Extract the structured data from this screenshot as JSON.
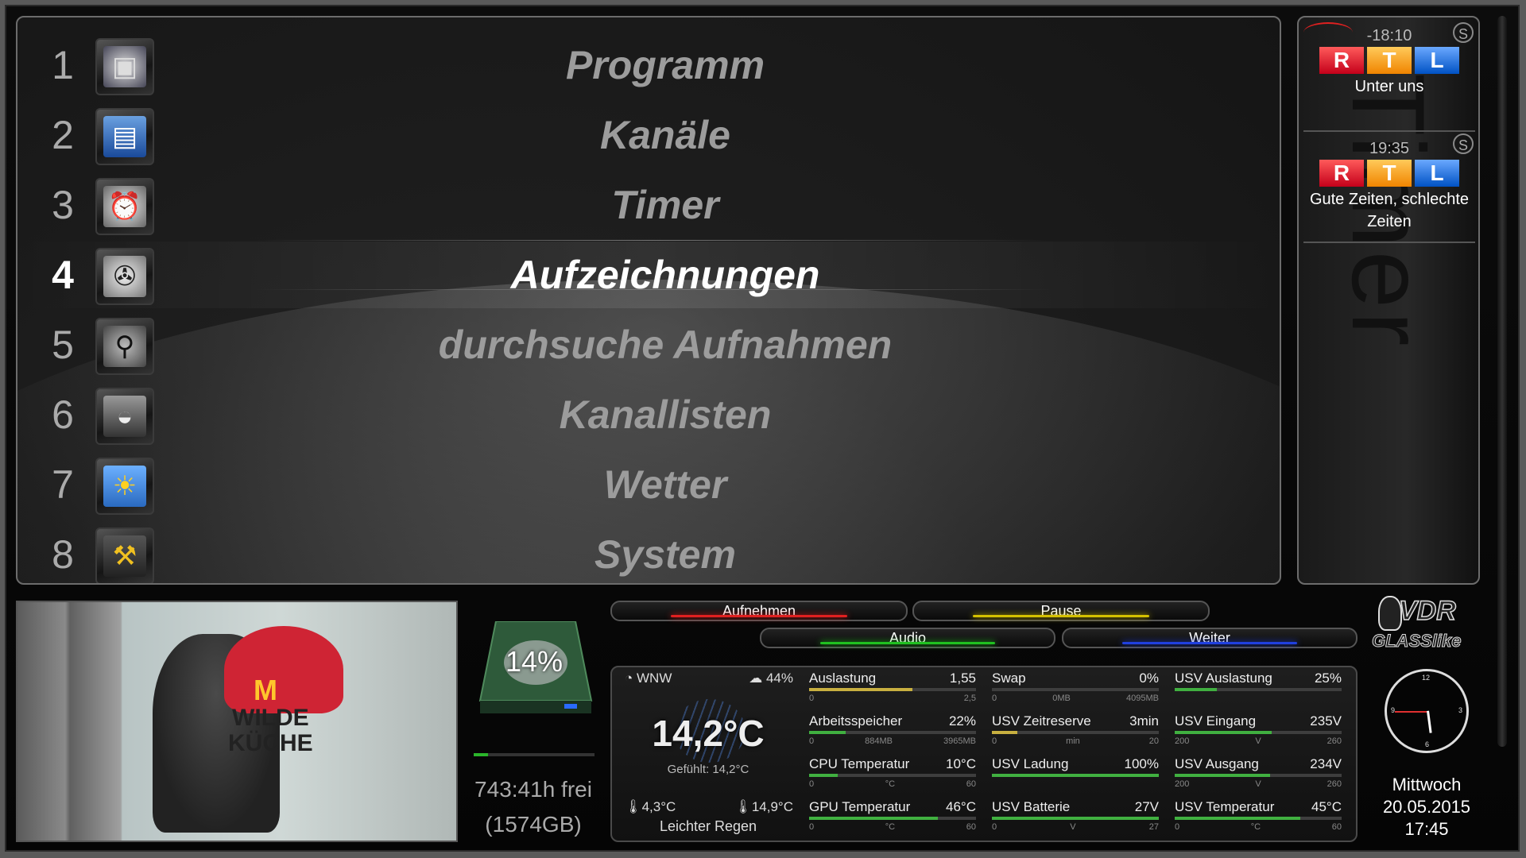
{
  "menu": {
    "items": [
      {
        "num": "1",
        "label": "Programm",
        "icon": "tv-epg-icon"
      },
      {
        "num": "2",
        "label": "Kanäle",
        "icon": "channels-icon"
      },
      {
        "num": "3",
        "label": "Timer",
        "icon": "alarm-clock-icon"
      },
      {
        "num": "4",
        "label": "Aufzeichnungen",
        "icon": "recordings-film-icon",
        "active": true
      },
      {
        "num": "5",
        "label": "durchsuche Aufnahmen",
        "icon": "magnifier-icon"
      },
      {
        "num": "6",
        "label": "Kanallisten",
        "icon": "satellite-dish-icon"
      },
      {
        "num": "7",
        "label": "Wetter",
        "icon": "weather-sun-cloud-icon"
      },
      {
        "num": "8",
        "label": "System",
        "icon": "drill-tools-icon"
      }
    ]
  },
  "timers": {
    "heading": "Timer",
    "entries": [
      {
        "time": "-18:10",
        "channel": "RTL",
        "title": "Unter uns",
        "badge": "S"
      },
      {
        "time": "19:35",
        "channel": "RTL",
        "title": "Gute Zeiten, schlechte Zeiten",
        "badge": "S"
      }
    ]
  },
  "disk": {
    "percent_label": "14%",
    "used_fraction": 0.12,
    "free_time": "743:41h frei",
    "free_size": "(1574GB)"
  },
  "buttons": {
    "red": "Aufnehmen",
    "yellow": "Pause",
    "green": "Audio",
    "blue": "Weiter",
    "colors": {
      "red": "#e02020",
      "yellow": "#d4c000",
      "green": "#20c020",
      "blue": "#2040e0"
    }
  },
  "weather": {
    "wind": "WNW",
    "rain_prob": "44%",
    "temp": "14,2°C",
    "feels": "Gefühlt: 14,2°C",
    "min": "4,3°C",
    "max": "14,9°C",
    "condition": "Leichter Regen"
  },
  "stats": [
    {
      "name": "Auslastung",
      "value": "1,55",
      "min": "0",
      "mid": "",
      "max": "2,5",
      "fill": 0.62,
      "color": "#c8b040"
    },
    {
      "name": "Swap",
      "value": "0%",
      "min": "0",
      "mid": "0MB",
      "max": "4095MB",
      "fill": 0.0,
      "color": "#40b040"
    },
    {
      "name": "USV Auslastung",
      "value": "25%",
      "min": "",
      "mid": "",
      "max": "",
      "fill": 0.25,
      "color": "#40b040"
    },
    {
      "name": "Arbeitsspeicher",
      "value": "22%",
      "min": "0",
      "mid": "884MB",
      "max": "3965MB",
      "fill": 0.22,
      "color": "#40b040"
    },
    {
      "name": "USV Zeitreserve",
      "value": "3min",
      "min": "0",
      "mid": "min",
      "max": "20",
      "fill": 0.15,
      "color": "#c8b040"
    },
    {
      "name": "USV Eingang",
      "value": "235V",
      "min": "200",
      "mid": "V",
      "max": "260",
      "fill": 0.58,
      "color": "#40b040"
    },
    {
      "name": "CPU Temperatur",
      "value": "10°C",
      "min": "0",
      "mid": "°C",
      "max": "60",
      "fill": 0.17,
      "color": "#40b040"
    },
    {
      "name": "USV Ladung",
      "value": "100%",
      "min": "",
      "mid": "",
      "max": "",
      "fill": 1.0,
      "color": "#40b040"
    },
    {
      "name": "USV Ausgang",
      "value": "234V",
      "min": "200",
      "mid": "V",
      "max": "260",
      "fill": 0.57,
      "color": "#40b040"
    },
    {
      "name": "GPU Temperatur",
      "value": "46°C",
      "min": "0",
      "mid": "°C",
      "max": "60",
      "fill": 0.77,
      "color": "#40b040"
    },
    {
      "name": "USV Batterie",
      "value": "27V",
      "min": "0",
      "mid": "V",
      "max": "27",
      "fill": 1.0,
      "color": "#40b040"
    },
    {
      "name": "USV Temperatur",
      "value": "45°C",
      "min": "0",
      "mid": "°C",
      "max": "60",
      "fill": 0.75,
      "color": "#40b040"
    }
  ],
  "logo": {
    "line1": "VDR",
    "line2": "GLASSlike"
  },
  "clock": {
    "hour": 5,
    "minute": 45,
    "labels": {
      "12": "12",
      "3": "3",
      "6": "6",
      "9": "9"
    }
  },
  "date": {
    "weekday": "Mittwoch",
    "date": "20.05.2015",
    "time": "17:45"
  },
  "video": {
    "show_text_line1": "WILDE",
    "show_text_line2": "KÜCHE",
    "logo": "M"
  }
}
